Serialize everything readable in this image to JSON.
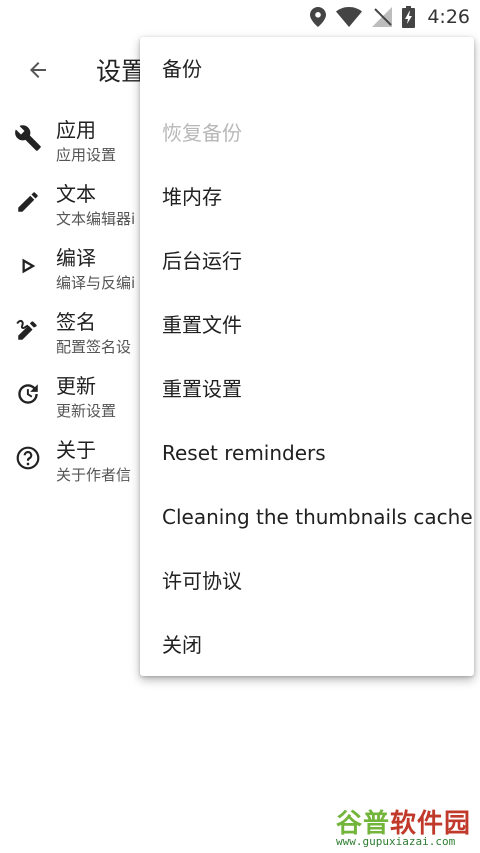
{
  "status_bar": {
    "time": "4:26",
    "icons": [
      "location-icon",
      "wifi-icon",
      "no-sim-icon",
      "battery-charging-icon"
    ]
  },
  "toolbar": {
    "title": "设置",
    "back_icon": "arrow-back-icon"
  },
  "settings": [
    {
      "title": "应用",
      "subtitle": "应用设置",
      "icon": "wrench-icon"
    },
    {
      "title": "文本",
      "subtitle": "文本编辑器i",
      "icon": "pencil-icon"
    },
    {
      "title": "编译",
      "subtitle": "编译与反编i",
      "icon": "play-outline-icon"
    },
    {
      "title": "签名",
      "subtitle": "配置签名设",
      "icon": "signature-icon"
    },
    {
      "title": "更新",
      "subtitle": "更新设置",
      "icon": "update-icon"
    },
    {
      "title": "关于",
      "subtitle": "关于作者信",
      "icon": "help-circle-icon"
    }
  ],
  "menu": {
    "items": [
      {
        "label": "备份",
        "enabled": true
      },
      {
        "label": "恢复备份",
        "enabled": false
      },
      {
        "label": "堆内存",
        "enabled": true
      },
      {
        "label": "后台运行",
        "enabled": true
      },
      {
        "label": "重置文件",
        "enabled": true
      },
      {
        "label": "重置设置",
        "enabled": true
      },
      {
        "label": "Reset reminders",
        "enabled": true
      },
      {
        "label": "Cleaning the thumbnails cache",
        "enabled": true
      },
      {
        "label": "许可协议",
        "enabled": true
      },
      {
        "label": "关闭",
        "enabled": true
      }
    ]
  },
  "watermark": {
    "part1": "谷普",
    "part2": "软件园",
    "url": "www.gupuxiazai.com"
  },
  "colors": {
    "text_primary": "#212121",
    "text_secondary": "#555555",
    "text_disabled": "#b8b8b8",
    "watermark_green": "#73b43b",
    "watermark_red": "#c0392b"
  }
}
